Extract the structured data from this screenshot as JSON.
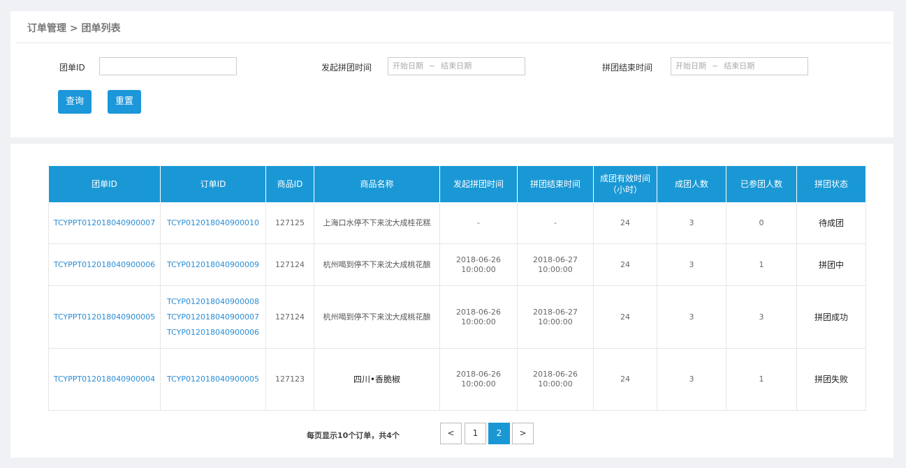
{
  "breadcrumb": "订单管理 > 团单列表",
  "filters": {
    "group_id_label": "团单ID",
    "group_id_value": "",
    "start_time_label": "发起拼团时间",
    "end_time_label": "拼团结束时间",
    "date_start_placeholder": "开始日期",
    "date_separator": "~",
    "date_end_placeholder": "结束日期",
    "query_button": "查询",
    "reset_button": "重置"
  },
  "table": {
    "headers": [
      "团单ID",
      "订单ID",
      "商品ID",
      "商品名称",
      "发起拼团时间",
      "拼团结束时间",
      "成团有效时间（小时）",
      "成团人数",
      "已参团人数",
      "拼团状态"
    ],
    "rows": [
      {
        "group_id": "TCYPPT012018040900007",
        "order_ids": [
          "TCYP012018040900010"
        ],
        "product_id": "127125",
        "product_name": "上海口水停不下来沈大成桂花糕",
        "start_date": "-",
        "start_time": "",
        "end_date": "-",
        "end_time": "",
        "valid_hours": "24",
        "required": "3",
        "joined": "0",
        "status": "待成团"
      },
      {
        "group_id": "TCYPPT012018040900006",
        "order_ids": [
          "TCYP012018040900009"
        ],
        "product_id": "127124",
        "product_name": "杭州喝到停不下来沈大成桃花酿",
        "start_date": "2018-06-26",
        "start_time": "10:00:00",
        "end_date": "2018-06-27",
        "end_time": "10:00:00",
        "valid_hours": "24",
        "required": "3",
        "joined": "1",
        "status": "拼团中"
      },
      {
        "group_id": "TCYPPT012018040900005",
        "order_ids": [
          "TCYP012018040900008",
          "TCYP012018040900007",
          "TCYP012018040900006"
        ],
        "product_id": "127124",
        "product_name": "杭州喝到停不下来沈大成桃花酿",
        "start_date": "2018-06-26",
        "start_time": "10:00:00",
        "end_date": "2018-06-27",
        "end_time": "10:00:00",
        "valid_hours": "24",
        "required": "3",
        "joined": "3",
        "status": "拼团成功"
      },
      {
        "group_id": "TCYPPT012018040900004",
        "order_ids": [
          "TCYP012018040900005"
        ],
        "product_id": "127123",
        "product_name": "四川•香脆椒",
        "start_date": "2018-06-26",
        "start_time": "10:00:00",
        "end_date": "2018-06-26",
        "end_time": "10:00:00",
        "valid_hours": "24",
        "required": "3",
        "joined": "1",
        "status": "拼团失败"
      }
    ]
  },
  "pagination": {
    "info": "每页显示10个订单，共4个",
    "prev": "<",
    "pages": [
      "1",
      "2"
    ],
    "current": "2",
    "next": ">"
  },
  "colors": {
    "accent": "#1a98d5",
    "link": "#2a8dd4"
  }
}
